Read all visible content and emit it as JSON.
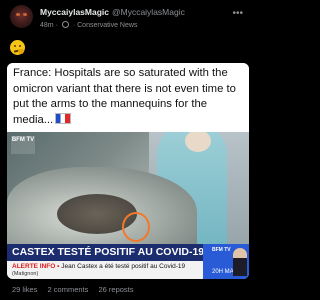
{
  "post": {
    "display_name": "MyccaiylasMagic",
    "handle": "@MyccaiylasMagic",
    "time": "48m",
    "dot": "·",
    "source": "Conservative News",
    "more": "•••"
  },
  "caption": {
    "text": "France: Hospitals are so saturated with the omicron variant that there is not even time to put the arms to the mannequins for the media..."
  },
  "chyron": {
    "headline": "CASTEX TESTÉ POSITIF AU COVID-19",
    "alert_label": "ALERTE INFO •",
    "alert_text": "Jean Castex a été testé positif au Covid-19",
    "location": "(Matignon)",
    "channel": "BFM TV",
    "time": "20H MAG"
  },
  "actions": {
    "likes": "29 likes",
    "comments": "2 comments",
    "reposts": "26 reposts"
  },
  "icons": {
    "emoji": "thinking-face-icon",
    "flag": "france-flag-icon",
    "globe": "globe-icon"
  }
}
